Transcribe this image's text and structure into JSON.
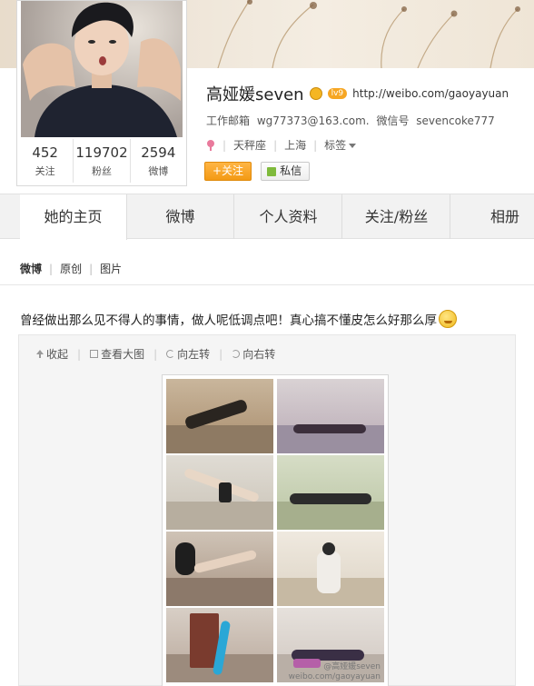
{
  "profile": {
    "name": "高娅媛seven",
    "level_badge": "lv9",
    "url": "http://weibo.com/gaoyayuan",
    "mail_label": "工作邮箱",
    "mail_value": "wg77373@163.com.",
    "wechat_label": "微信号",
    "wechat_value": "sevencoke777",
    "zodiac": "天秤座",
    "city": "上海",
    "tags_label": "标签",
    "follow_label": "+关注",
    "message_label": "私信"
  },
  "stats": [
    {
      "value": "452",
      "label": "关注"
    },
    {
      "value": "119702",
      "label": "粉丝"
    },
    {
      "value": "2594",
      "label": "微博"
    }
  ],
  "tabs": [
    "她的主页",
    "微博",
    "个人资料",
    "关注/粉丝",
    "相册"
  ],
  "filters": [
    "微博",
    "原创",
    "图片"
  ],
  "post": {
    "text": "曾经做出那么见不得人的事情，做人呢低调点吧！真心搞不懂皮怎么好那么厚"
  },
  "media_tools": [
    "收起",
    "查看大图",
    "向左转",
    "向右转"
  ],
  "watermark": {
    "handle": "@高娅媛seven",
    "site": "weibo.com/gaoyayuan"
  }
}
